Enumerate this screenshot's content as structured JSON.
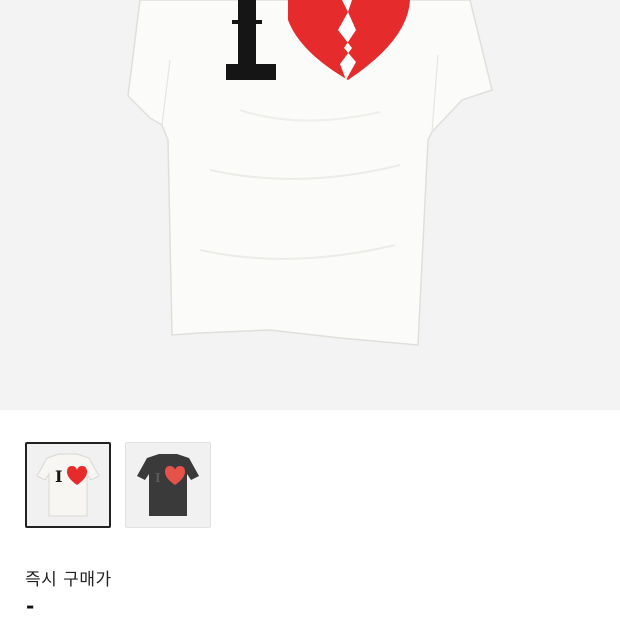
{
  "product": {
    "images": [
      {
        "name": "white-tshirt-broken-heart",
        "selected": true
      },
      {
        "name": "black-tshirt-broken-heart",
        "selected": false
      }
    ],
    "main_image_letter": "I",
    "thumb_letter": "I"
  },
  "price": {
    "label": "즉시 구매가",
    "value": "-"
  },
  "colors": {
    "hero_bg": "#f3f3f3",
    "heart_red": "#e52b2b",
    "shirt_white": "#fbfbf9",
    "shirt_black": "#3a3a3a",
    "selected_border": "#222222"
  }
}
